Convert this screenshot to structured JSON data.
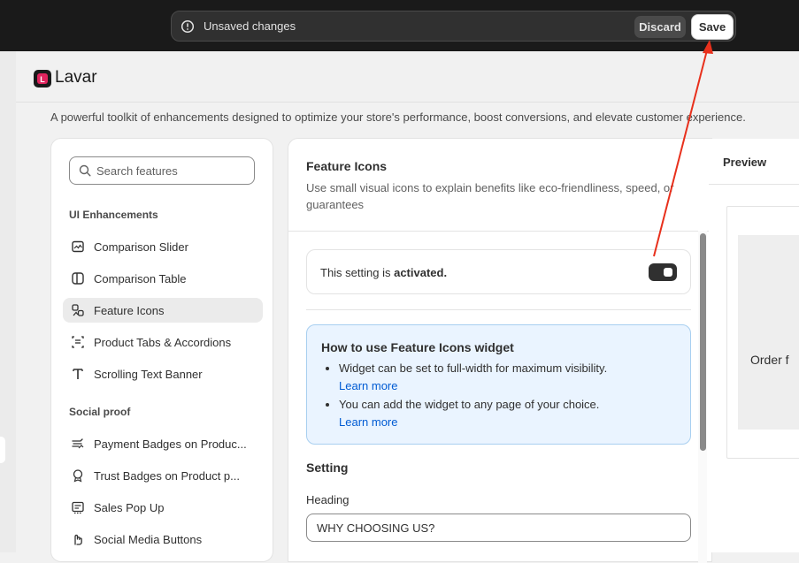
{
  "save_bar": {
    "message": "Unsaved changes",
    "discard_label": "Discard",
    "save_label": "Save",
    "icon": "alert-circle-icon"
  },
  "app": {
    "name": "Lavar",
    "description": "A powerful toolkit of enhancements designed to optimize your store's performance, boost conversions, and elevate customer experience."
  },
  "sidebar": {
    "search": {
      "placeholder": "Search features",
      "value": ""
    },
    "sections": [
      {
        "title": "UI Enhancements",
        "items": [
          {
            "label": "Comparison Slider",
            "icon": "comparison-slider-icon",
            "active": false
          },
          {
            "label": "Comparison Table",
            "icon": "comparison-table-icon",
            "active": false
          },
          {
            "label": "Feature Icons",
            "icon": "feature-icons-icon",
            "active": true
          },
          {
            "label": "Product Tabs & Accordions",
            "icon": "tabs-icon",
            "active": false
          },
          {
            "label": "Scrolling Text Banner",
            "icon": "text-icon",
            "active": false
          }
        ]
      },
      {
        "title": "Social proof",
        "items": [
          {
            "label": "Payment Badges on Produc...",
            "icon": "payment-icon",
            "active": false
          },
          {
            "label": "Trust Badges on Product p...",
            "icon": "badge-icon",
            "active": false
          },
          {
            "label": "Sales Pop Up",
            "icon": "popup-icon",
            "active": false
          },
          {
            "label": "Social Media Buttons",
            "icon": "hand-icon",
            "active": false
          }
        ]
      }
    ]
  },
  "feature": {
    "title": "Feature Icons",
    "description": "Use small visual icons to explain benefits like eco-friendliness, speed, or guarantees",
    "activation_prefix": "This setting is ",
    "activation_status": "activated.",
    "toggle_on": true,
    "howto": {
      "title": "How to use Feature Icons widget",
      "bullets": [
        {
          "text": "Widget can be set to full-width for maximum visibility.",
          "link": "Learn more"
        },
        {
          "text": "You can add the widget to any page of your choice.",
          "link": "Learn more"
        }
      ]
    },
    "setting_title": "Setting",
    "heading_label": "Heading",
    "heading_value": "WHY CHOOSING US?"
  },
  "preview": {
    "label": "Preview",
    "partial_text": "Order f"
  },
  "colors": {
    "topbar": "#1a1a1a",
    "info_bg": "#eaf4ff",
    "link": "#005bd3",
    "annotation_arrow": "#e8301c"
  }
}
